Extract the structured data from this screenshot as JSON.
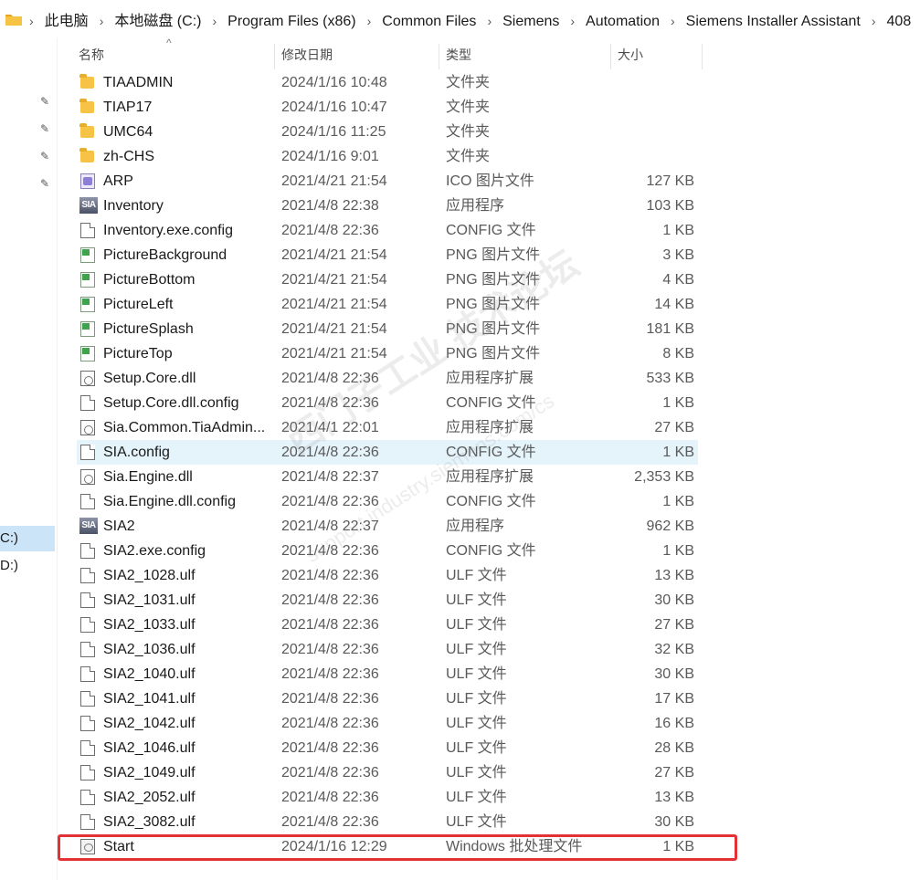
{
  "breadcrumb": [
    "此电脑",
    "本地磁盘 (C:)",
    "Program Files (x86)",
    "Common Files",
    "Siemens",
    "Automation",
    "Siemens Installer Assistant",
    "408"
  ],
  "nav": {
    "drives": [
      "C:)",
      "D:)"
    ]
  },
  "columns": {
    "name": "名称",
    "date": "修改日期",
    "type": "类型",
    "size": "大小"
  },
  "files": [
    {
      "name": "TIAADMIN",
      "date": "2024/1/16 10:48",
      "type": "文件夹",
      "size": "",
      "icon": "folder-icon"
    },
    {
      "name": "TIAP17",
      "date": "2024/1/16 10:47",
      "type": "文件夹",
      "size": "",
      "icon": "folder-icon"
    },
    {
      "name": "UMC64",
      "date": "2024/1/16 11:25",
      "type": "文件夹",
      "size": "",
      "icon": "folder-icon"
    },
    {
      "name": "zh-CHS",
      "date": "2024/1/16 9:01",
      "type": "文件夹",
      "size": "",
      "icon": "folder-icon"
    },
    {
      "name": "ARP",
      "date": "2021/4/21 21:54",
      "type": "ICO 图片文件",
      "size": "127 KB",
      "icon": "ico-file-icon"
    },
    {
      "name": "Inventory",
      "date": "2021/4/8 22:38",
      "type": "应用程序",
      "size": "103 KB",
      "icon": "sia-app-icon"
    },
    {
      "name": "Inventory.exe.config",
      "date": "2021/4/8 22:36",
      "type": "CONFIG 文件",
      "size": "1 KB",
      "icon": "document-icon"
    },
    {
      "name": "PictureBackground",
      "date": "2021/4/21 21:54",
      "type": "PNG 图片文件",
      "size": "3 KB",
      "icon": "png-file-icon"
    },
    {
      "name": "PictureBottom",
      "date": "2021/4/21 21:54",
      "type": "PNG 图片文件",
      "size": "4 KB",
      "icon": "png-file-icon"
    },
    {
      "name": "PictureLeft",
      "date": "2021/4/21 21:54",
      "type": "PNG 图片文件",
      "size": "14 KB",
      "icon": "png-file-icon"
    },
    {
      "name": "PictureSplash",
      "date": "2021/4/21 21:54",
      "type": "PNG 图片文件",
      "size": "181 KB",
      "icon": "png-file-icon"
    },
    {
      "name": "PictureTop",
      "date": "2021/4/21 21:54",
      "type": "PNG 图片文件",
      "size": "8 KB",
      "icon": "png-file-icon"
    },
    {
      "name": "Setup.Core.dll",
      "date": "2021/4/8 22:36",
      "type": "应用程序扩展",
      "size": "533 KB",
      "icon": "dll-file-icon"
    },
    {
      "name": "Setup.Core.dll.config",
      "date": "2021/4/8 22:36",
      "type": "CONFIG 文件",
      "size": "1 KB",
      "icon": "document-icon"
    },
    {
      "name": "Sia.Common.TiaAdmin...",
      "date": "2021/4/1 22:01",
      "type": "应用程序扩展",
      "size": "27 KB",
      "icon": "dll-file-icon"
    },
    {
      "name": "SIA.config",
      "date": "2021/4/8 22:36",
      "type": "CONFIG 文件",
      "size": "1 KB",
      "icon": "document-icon",
      "highlight": true
    },
    {
      "name": "Sia.Engine.dll",
      "date": "2021/4/8 22:37",
      "type": "应用程序扩展",
      "size": "2,353 KB",
      "icon": "dll-file-icon"
    },
    {
      "name": "Sia.Engine.dll.config",
      "date": "2021/4/8 22:36",
      "type": "CONFIG 文件",
      "size": "1 KB",
      "icon": "document-icon"
    },
    {
      "name": "SIA2",
      "date": "2021/4/8 22:37",
      "type": "应用程序",
      "size": "962 KB",
      "icon": "sia-app-icon"
    },
    {
      "name": "SIA2.exe.config",
      "date": "2021/4/8 22:36",
      "type": "CONFIG 文件",
      "size": "1 KB",
      "icon": "document-icon"
    },
    {
      "name": "SIA2_1028.ulf",
      "date": "2021/4/8 22:36",
      "type": "ULF 文件",
      "size": "13 KB",
      "icon": "document-icon"
    },
    {
      "name": "SIA2_1031.ulf",
      "date": "2021/4/8 22:36",
      "type": "ULF 文件",
      "size": "30 KB",
      "icon": "document-icon"
    },
    {
      "name": "SIA2_1033.ulf",
      "date": "2021/4/8 22:36",
      "type": "ULF 文件",
      "size": "27 KB",
      "icon": "document-icon"
    },
    {
      "name": "SIA2_1036.ulf",
      "date": "2021/4/8 22:36",
      "type": "ULF 文件",
      "size": "32 KB",
      "icon": "document-icon"
    },
    {
      "name": "SIA2_1040.ulf",
      "date": "2021/4/8 22:36",
      "type": "ULF 文件",
      "size": "30 KB",
      "icon": "document-icon"
    },
    {
      "name": "SIA2_1041.ulf",
      "date": "2021/4/8 22:36",
      "type": "ULF 文件",
      "size": "17 KB",
      "icon": "document-icon"
    },
    {
      "name": "SIA2_1042.ulf",
      "date": "2021/4/8 22:36",
      "type": "ULF 文件",
      "size": "16 KB",
      "icon": "document-icon"
    },
    {
      "name": "SIA2_1046.ulf",
      "date": "2021/4/8 22:36",
      "type": "ULF 文件",
      "size": "28 KB",
      "icon": "document-icon"
    },
    {
      "name": "SIA2_1049.ulf",
      "date": "2021/4/8 22:36",
      "type": "ULF 文件",
      "size": "27 KB",
      "icon": "document-icon"
    },
    {
      "name": "SIA2_2052.ulf",
      "date": "2021/4/8 22:36",
      "type": "ULF 文件",
      "size": "13 KB",
      "icon": "document-icon"
    },
    {
      "name": "SIA2_3082.ulf",
      "date": "2021/4/8 22:36",
      "type": "ULF 文件",
      "size": "30 KB",
      "icon": "document-icon"
    },
    {
      "name": "Start",
      "date": "2024/1/16 12:29",
      "type": "Windows 批处理文件",
      "size": "1 KB",
      "icon": "batch-file-icon",
      "annotated": true
    }
  ],
  "watermark": {
    "line1": "西门子工业 技术论坛",
    "line2": "support.industry.siemens.com/cs"
  },
  "colors": {
    "selection": "#cce4f7",
    "hover": "#e5f3fb",
    "annotation_box": "#e33236",
    "folder": "#f6c344"
  }
}
